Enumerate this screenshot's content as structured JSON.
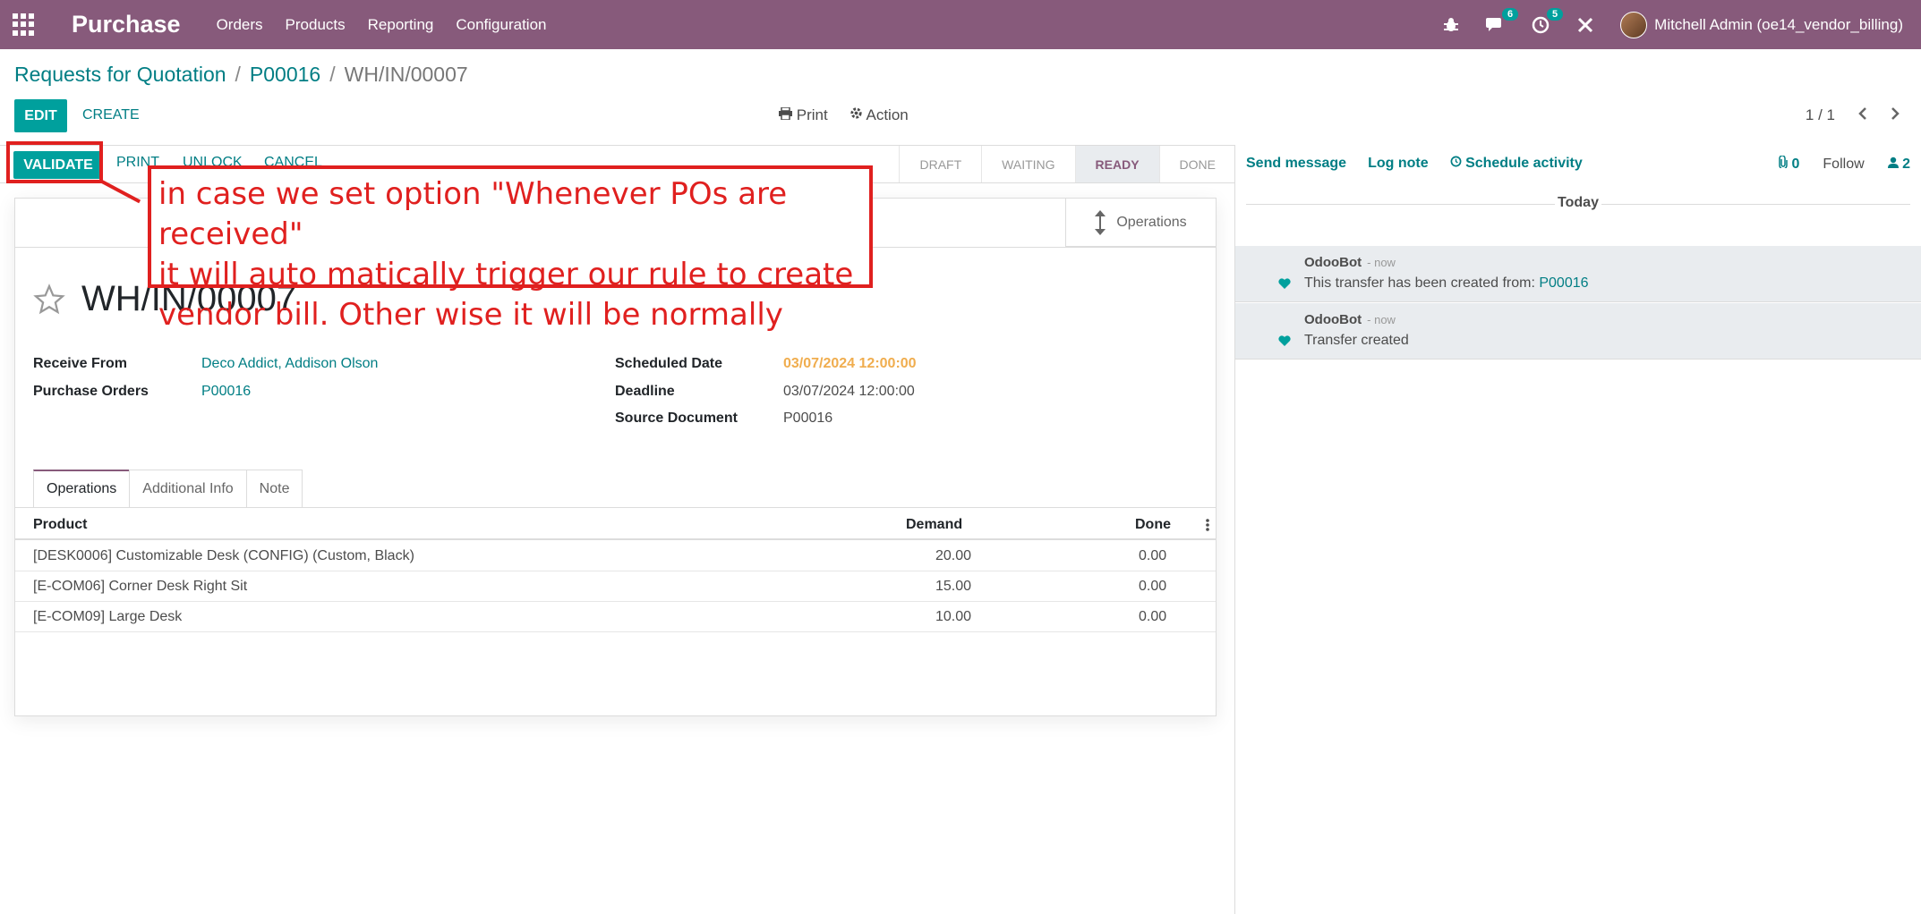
{
  "navbar": {
    "app_name": "Purchase",
    "menu": [
      "Orders",
      "Products",
      "Reporting",
      "Configuration"
    ],
    "messages_badge": "6",
    "activities_badge": "5",
    "user": "Mitchell Admin (oe14_vendor_billing)"
  },
  "breadcrumb": {
    "root": "Requests for Quotation",
    "parent": "P00016",
    "current": "WH/IN/00007",
    "sep": "/"
  },
  "toolbar": {
    "edit": "EDIT",
    "create": "CREATE",
    "print": "Print",
    "action": "Action",
    "pager": "1 / 1"
  },
  "statusbar": {
    "validate": "VALIDATE",
    "print": "PRINT",
    "unlock": "UNLOCK",
    "cancel": "CANCEL",
    "stages": [
      "DRAFT",
      "WAITING",
      "READY",
      "DONE"
    ],
    "active_stage": "READY"
  },
  "sheet": {
    "smart_button": "Operations",
    "title": "WH/IN/00007",
    "fields": {
      "receive_from_label": "Receive From",
      "receive_from": "Deco Addict, Addison Olson",
      "purchase_orders_label": "Purchase Orders",
      "purchase_orders": "P00016",
      "scheduled_date_label": "Scheduled Date",
      "scheduled_date": "03/07/2024 12:00:00",
      "deadline_label": "Deadline",
      "deadline": "03/07/2024 12:00:00",
      "source_document_label": "Source Document",
      "source_document": "P00016"
    },
    "tabs": [
      "Operations",
      "Additional Info",
      "Note"
    ],
    "table": {
      "headers": {
        "product": "Product",
        "demand": "Demand",
        "done": "Done"
      },
      "rows": [
        {
          "product": "[DESK0006] Customizable Desk (CONFIG) (Custom, Black)",
          "demand": "20.00",
          "done": "0.00"
        },
        {
          "product": "[E-COM06] Corner Desk Right Sit",
          "demand": "15.00",
          "done": "0.00"
        },
        {
          "product": "[E-COM09] Large Desk",
          "demand": "10.00",
          "done": "0.00"
        }
      ]
    }
  },
  "chatter": {
    "send_message": "Send message",
    "log_note": "Log note",
    "schedule_activity": "Schedule activity",
    "attachments": "0",
    "follow": "Follow",
    "followers": "2",
    "today": "Today",
    "messages": [
      {
        "author": "OdooBot",
        "when": "- now",
        "body": "This transfer has been created from:",
        "link": "P00016"
      },
      {
        "author": "OdooBot",
        "when": "- now",
        "body": "Transfer created",
        "link": ""
      }
    ]
  },
  "annotation": {
    "text": "in case we set option \"Whenever POs are received\"\nit will auto matically trigger our rule to create\nvendor bill. Other wise it will be normally"
  },
  "colors": {
    "navbar": "#875a7b",
    "primary": "#00a09d",
    "link": "#017e84",
    "warning": "#f0ad4e",
    "annotation": "#e0201f"
  }
}
